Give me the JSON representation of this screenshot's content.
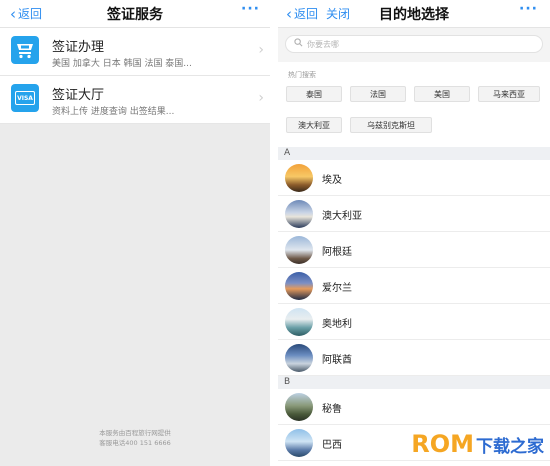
{
  "left": {
    "back_label": "返回",
    "title": "签证服务",
    "more_label": "···",
    "items": [
      {
        "icon": "visa-shop-icon",
        "title": "签证办理",
        "subtitle": "美国 加拿大 日本 韩国 法国 泰国..."
      },
      {
        "icon": "visa-card-icon",
        "icon_text": "VISA",
        "title": "签证大厅",
        "subtitle": "资料上传 进度查询 出签结果..."
      }
    ],
    "footer_line1": "本服务由百程旅行网提供",
    "footer_line2": "客服电话400 151 6666"
  },
  "right": {
    "back_label": "返回",
    "close_label": "关闭",
    "title": "目的地选择",
    "more_label": "···",
    "search_placeholder": "你要去哪",
    "hot_label": "热门搜索",
    "hot_tags": [
      "泰国",
      "法国",
      "美国",
      "马来西亚",
      "澳大利亚",
      "乌兹别克斯坦"
    ],
    "sections": [
      {
        "letter": "A",
        "countries": [
          "埃及",
          "澳大利亚",
          "阿根廷",
          "爱尔兰",
          "奥地利",
          "阿联酋"
        ]
      },
      {
        "letter": "B",
        "countries": [
          "秘鲁",
          "巴西"
        ]
      }
    ]
  },
  "watermark": {
    "brand": "ROM",
    "suffix": "下载之家"
  },
  "colors": {
    "accent": "#2f8ef0",
    "icon_bg": "#25a3ec",
    "watermark_orange": "#f5a623",
    "watermark_blue": "#2d6bd1"
  }
}
